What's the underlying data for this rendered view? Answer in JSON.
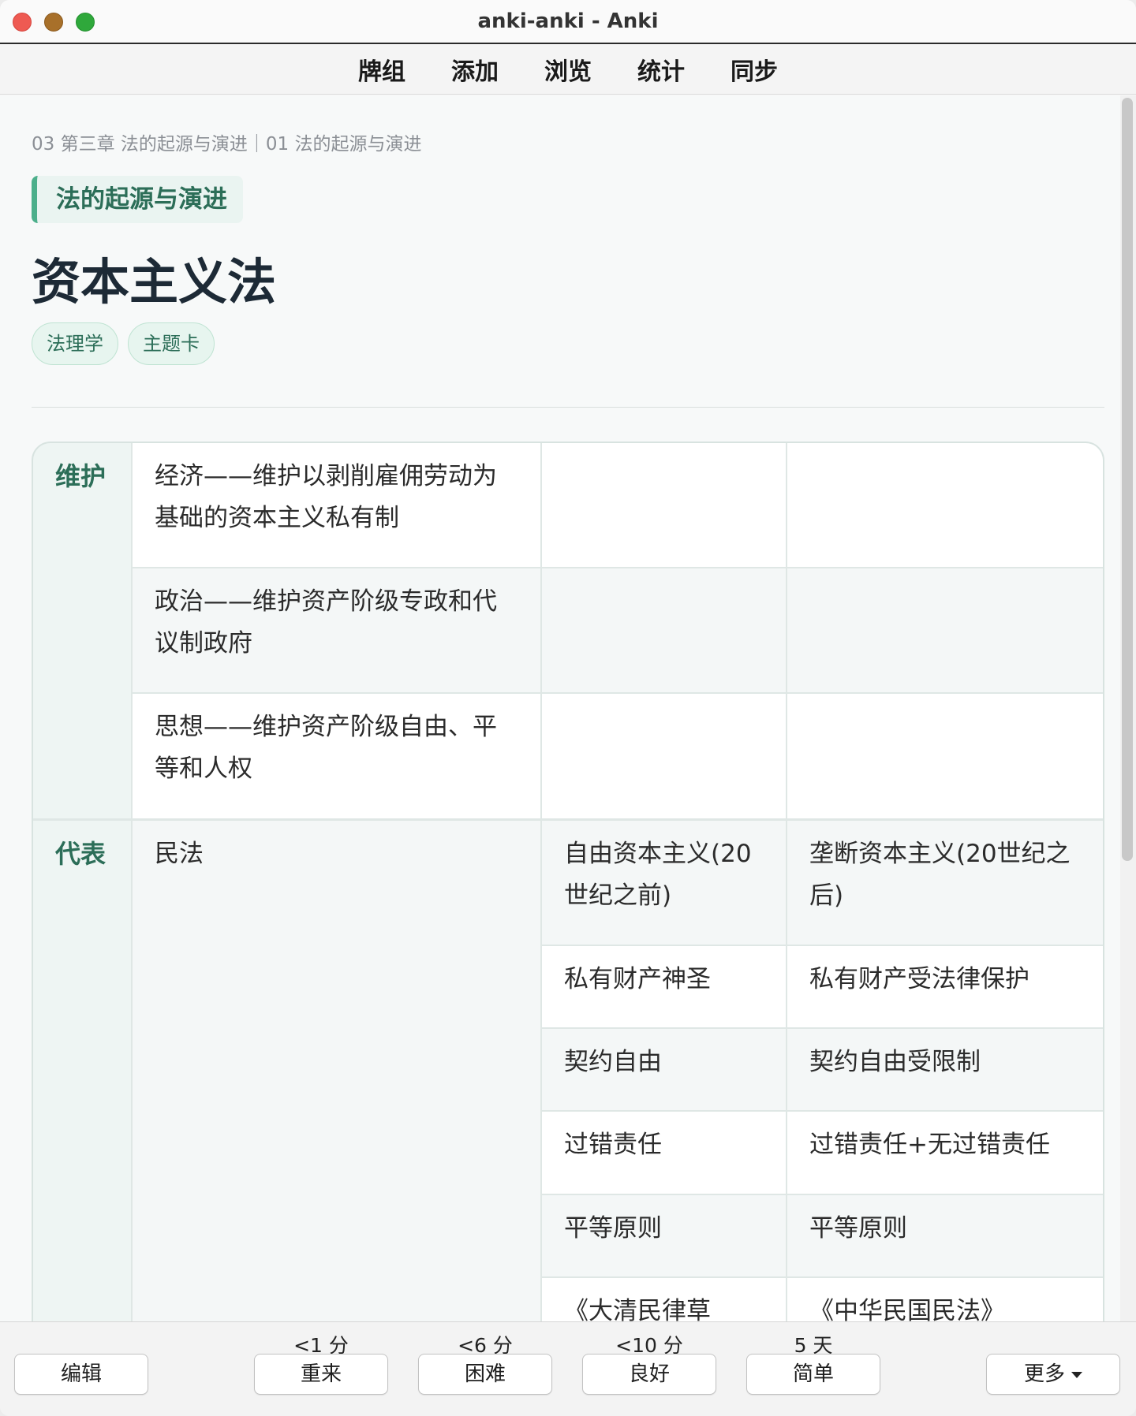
{
  "window": {
    "title": "anki-anki - Anki"
  },
  "nav": {
    "items": [
      "牌组",
      "添加",
      "浏览",
      "统计",
      "同步"
    ]
  },
  "card": {
    "breadcrumb": "03 第三章 法的起源与演进｜01 法的起源与演进",
    "section": "法的起源与演进",
    "title": "资本主义法",
    "tags": [
      "法理学",
      "主题卡"
    ]
  },
  "table": {
    "maintain": {
      "header": "维护",
      "rows": [
        "经济——维护以剥削雇佣劳动为基础的资本主义私有制",
        "政治——维护资产阶级专政和代议制政府",
        "思想——维护资产阶级自由、平等和人权"
      ]
    },
    "represent": {
      "header": "代表",
      "law": "民法",
      "col_a": [
        "自由资本主义(20世纪之前)",
        "私有财产神圣",
        "契约自由",
        "过错责任",
        "平等原则",
        "《大清民律草"
      ],
      "col_b": [
        "垄断资本主义(20世纪之后)",
        "私有财产受法律保护",
        "契约自由受限制",
        "过错责任+无过错责任",
        "平等原则",
        "《中华民国民法》"
      ]
    }
  },
  "bottom": {
    "edit": "编辑",
    "more": "更多",
    "answers": [
      {
        "due": "<1 分",
        "label": "重来"
      },
      {
        "due": "<6 分",
        "label": "困难"
      },
      {
        "due": "<10 分",
        "label": "良好"
      },
      {
        "due": "5 天",
        "label": "简单"
      }
    ]
  }
}
